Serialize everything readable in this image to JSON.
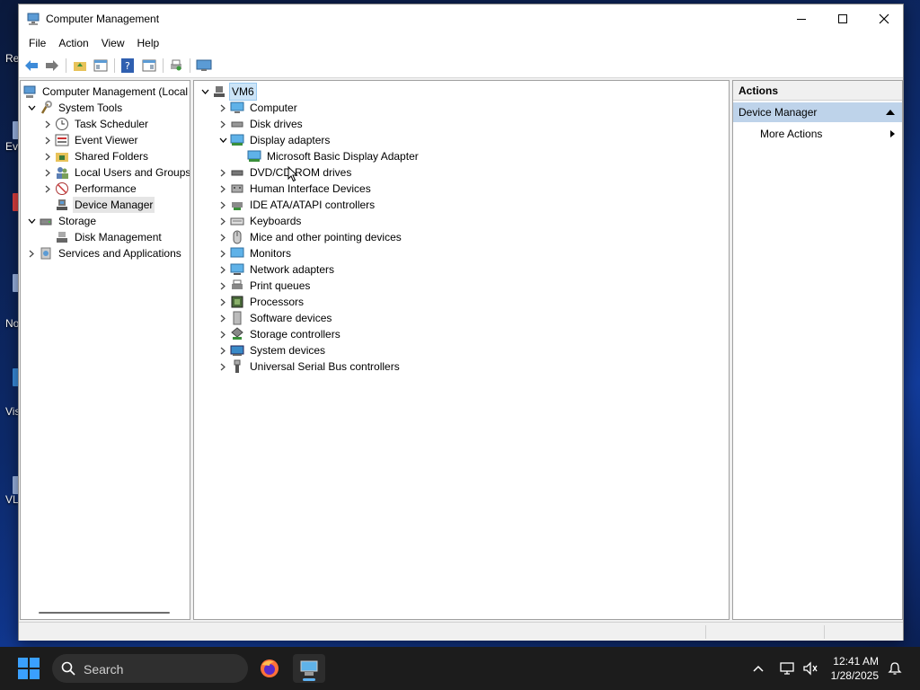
{
  "desktop": {
    "fragments": [
      "Re",
      "Ev",
      "No",
      "Vis",
      "VL"
    ]
  },
  "window": {
    "title": "Computer Management",
    "menu": [
      "File",
      "Action",
      "View",
      "Help"
    ]
  },
  "left_tree": {
    "root": "Computer Management (Local",
    "items": [
      {
        "label": "System Tools"
      },
      {
        "label": "Task Scheduler"
      },
      {
        "label": "Event Viewer"
      },
      {
        "label": "Shared Folders"
      },
      {
        "label": "Local Users and Groups"
      },
      {
        "label": "Performance"
      },
      {
        "label": "Device Manager"
      },
      {
        "label": "Storage"
      },
      {
        "label": "Disk Management"
      },
      {
        "label": "Services and Applications"
      }
    ]
  },
  "device_tree": {
    "root": "VM6",
    "items": [
      {
        "label": "Computer"
      },
      {
        "label": "Disk drives"
      },
      {
        "label": "Display adapters"
      },
      {
        "label": "Microsoft Basic Display Adapter"
      },
      {
        "label": "DVD/CD-ROM drives"
      },
      {
        "label": "Human Interface Devices"
      },
      {
        "label": "IDE ATA/ATAPI controllers"
      },
      {
        "label": "Keyboards"
      },
      {
        "label": "Mice and other pointing devices"
      },
      {
        "label": "Monitors"
      },
      {
        "label": "Network adapters"
      },
      {
        "label": "Print queues"
      },
      {
        "label": "Processors"
      },
      {
        "label": "Software devices"
      },
      {
        "label": "Storage controllers"
      },
      {
        "label": "System devices"
      },
      {
        "label": "Universal Serial Bus controllers"
      }
    ]
  },
  "actions": {
    "header": "Actions",
    "section": "Device Manager",
    "item": "More Actions"
  },
  "taskbar": {
    "search_placeholder": "Search",
    "time": "12:41 AM",
    "date": "1/28/2025"
  },
  "colors": {
    "selection_bg": "#cce4f7",
    "actions_section_bg": "#bed3ea",
    "taskbar_bg": "#1c1c1c",
    "start_blue": "#3aa0ff"
  }
}
